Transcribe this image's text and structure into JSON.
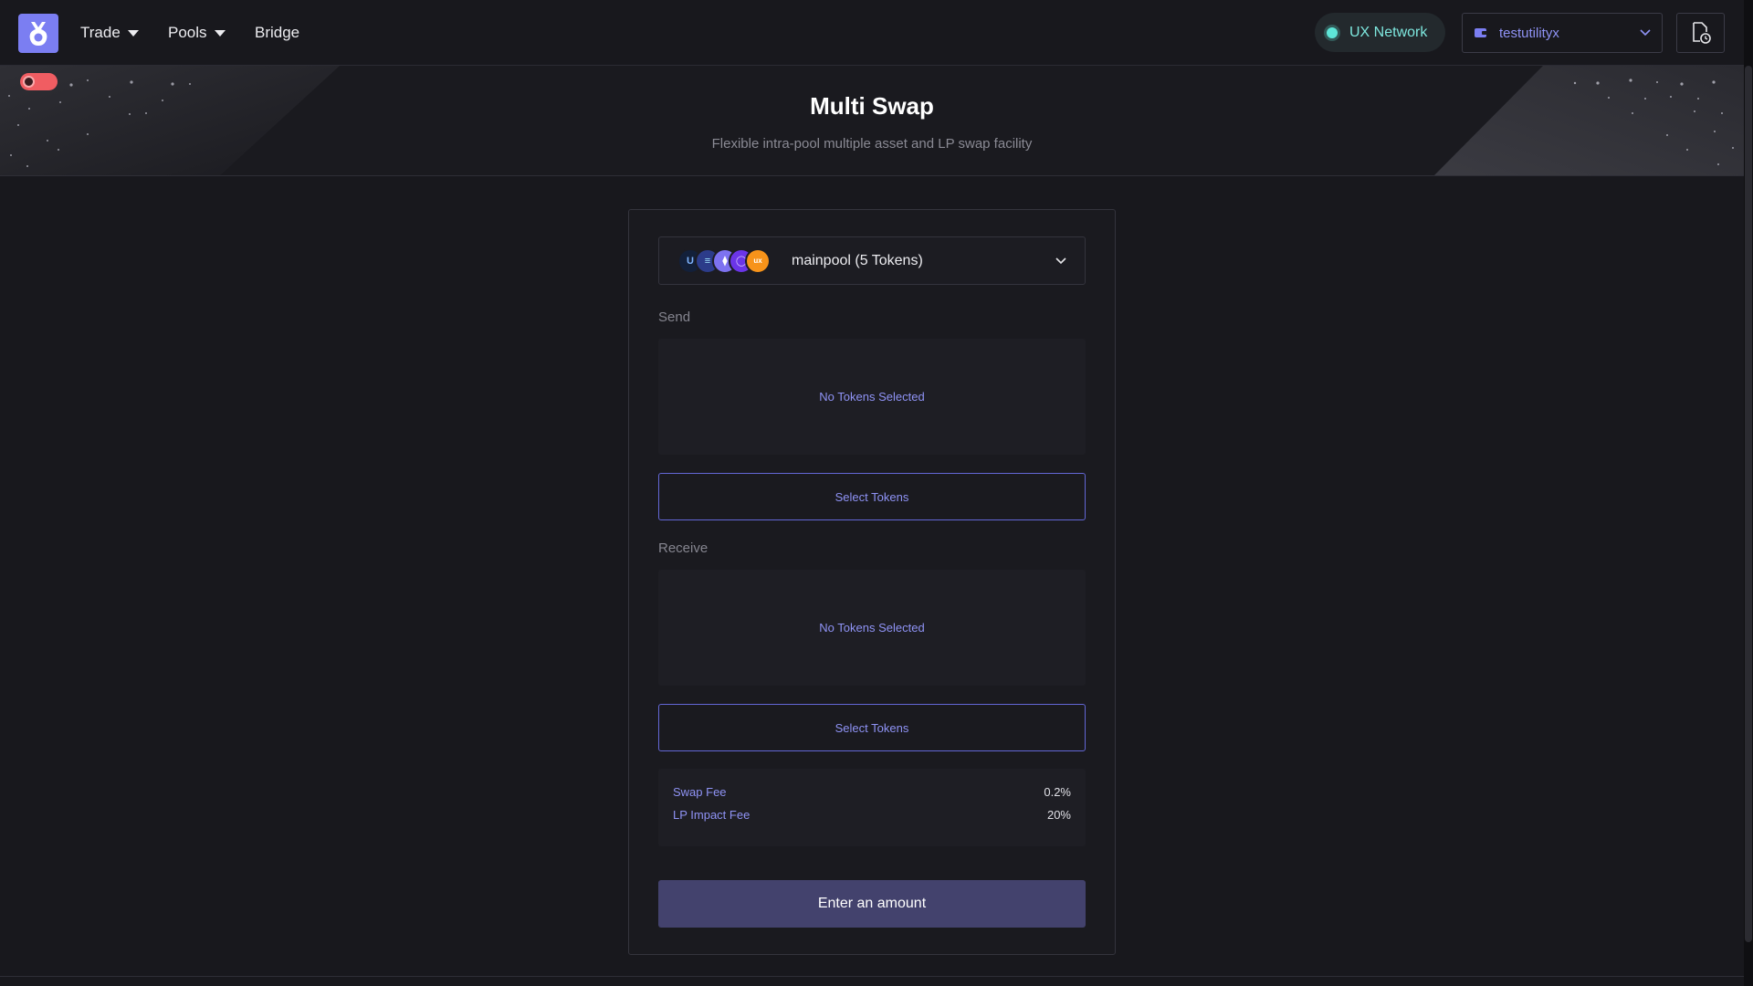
{
  "nav": {
    "trade_label": "Trade",
    "pools_label": "Pools",
    "bridge_label": "Bridge",
    "network_label": "UX Network",
    "account_name": "testutilityx"
  },
  "hero": {
    "title": "Multi Swap",
    "subtitle": "Flexible intra-pool multiple asset and LP swap facility"
  },
  "swap": {
    "pool_label": "mainpool (5 Tokens)",
    "pool_tokens": [
      "U",
      "≡",
      "⧫",
      "◯",
      "ux"
    ],
    "send_label": "Send",
    "send_empty": "No Tokens Selected",
    "send_button": "Select Tokens",
    "receive_label": "Receive",
    "receive_empty": "No Tokens Selected",
    "receive_button": "Select Tokens",
    "fees": [
      {
        "label": "Swap Fee",
        "value": "0.2%"
      },
      {
        "label": "LP Impact Fee",
        "value": "20%"
      }
    ],
    "cta_label": "Enter an amount"
  },
  "colors": {
    "accent": "#8f93f5",
    "network_accent": "#5ee6d8",
    "toggle": "#f05d62",
    "cta_bg": "#43426d",
    "background": "#18181d"
  }
}
